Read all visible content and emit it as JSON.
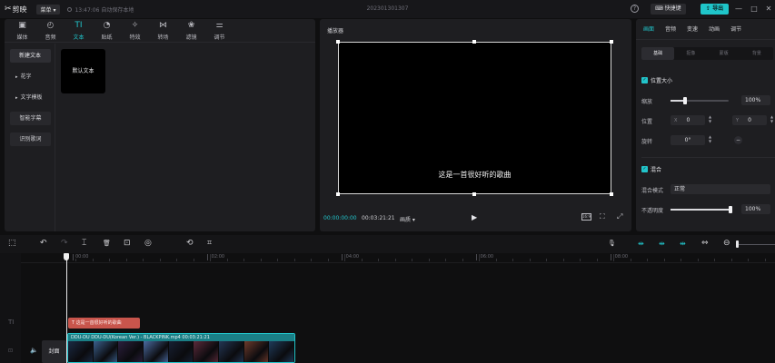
{
  "app": {
    "name": "剪映",
    "menu_label": "菜单",
    "save_status": "13:47:06 自动保存本地",
    "project_name": "202301301307",
    "help": "?",
    "shortcut_label": "快捷键",
    "export_label": "导出",
    "window_controls": {
      "minimize": "—",
      "maximize": "□",
      "close": "✕"
    }
  },
  "media": {
    "tabs": [
      {
        "label": "媒体",
        "icon": "media-icon",
        "glyph": "▣",
        "active": false
      },
      {
        "label": "音频",
        "icon": "audio-icon",
        "glyph": "◴",
        "active": false
      },
      {
        "label": "文本",
        "icon": "text-icon",
        "glyph": "TI",
        "active": true
      },
      {
        "label": "贴纸",
        "icon": "sticker-icon",
        "glyph": "◔",
        "active": false
      },
      {
        "label": "特效",
        "icon": "effects-icon",
        "glyph": "✧",
        "active": false
      },
      {
        "label": "转场",
        "icon": "transition-icon",
        "glyph": "⋈",
        "active": false
      },
      {
        "label": "滤镜",
        "icon": "filter-icon",
        "glyph": "❀",
        "active": false
      },
      {
        "label": "调节",
        "icon": "adjust-icon",
        "glyph": "⚌",
        "active": false
      }
    ],
    "sidebar": [
      {
        "label": "新建文本",
        "style": "active"
      },
      {
        "label": "花字",
        "style": "caret"
      },
      {
        "label": "文字模板",
        "style": "caret"
      },
      {
        "label": "智能字幕",
        "style": "plain"
      },
      {
        "label": "识别歌词",
        "style": "plain"
      }
    ],
    "caret_glyph": "▸",
    "preset_card": "默认文本"
  },
  "player": {
    "title": "播放器",
    "subtitle": "这是一首很好听的歌曲",
    "current_time": "00:00:00:00",
    "total_time": "00:03:21:21",
    "quality": "画质 ▾",
    "play_glyph": "▶",
    "ratio_glyph": "16:9",
    "expand_glyph": "⛶",
    "fullscreen_glyph": "⤢"
  },
  "properties": {
    "tabs": [
      {
        "label": "画面",
        "active": true
      },
      {
        "label": "音频",
        "active": false
      },
      {
        "label": "变速",
        "active": false
      },
      {
        "label": "动画",
        "active": false
      },
      {
        "label": "调节",
        "active": false
      }
    ],
    "subtabs": [
      {
        "label": "基础",
        "active": true
      },
      {
        "label": "抠像",
        "active": false
      },
      {
        "label": "蒙版",
        "active": false
      },
      {
        "label": "背景",
        "active": false
      }
    ],
    "check_glyph": "✓",
    "position_size": {
      "title": "位置大小",
      "scale_label": "缩放",
      "scale_value": "100%",
      "scale_fraction": 0.25,
      "position_label": "位置",
      "x_axis": "X",
      "x_value": "0",
      "y_axis": "Y",
      "y_value": "0",
      "rotate_label": "旋转",
      "rotate_value": "0°",
      "reset_glyph": "−"
    },
    "blend": {
      "title": "混合",
      "mode_label": "混合模式",
      "mode_value": "正常",
      "opacity_label": "不透明度",
      "opacity_value": "100%",
      "opacity_fraction": 1.0
    },
    "step_up": "▲",
    "step_down": "▼"
  },
  "timeline": {
    "tools": {
      "select": "⬚",
      "undo": "↶",
      "redo": "↷",
      "split": "⌶",
      "delete": "🗑",
      "freeze": "⊡",
      "reverse": "◎",
      "mirror": "⟲",
      "crop": "⌗",
      "mic": "🎙",
      "link_a": "⇹",
      "link_b": "⇹",
      "link_c": "⇹",
      "align": "⇔",
      "zoom_out": "⊖"
    },
    "ruler_ticks": [
      "00:00",
      "|02:00",
      "|04:00",
      "|06:00",
      "|08:00"
    ],
    "text_track_label": "TI",
    "text_clip_label": "这是一首很好听的歌曲",
    "video_track_icon": "⊡",
    "audio_icon": "🔈",
    "cover_label": "封面",
    "video_clip_name": "DDU-DU DDU-DU(Korean Ver.) - BLACKPINK.mp4  00:03:21:21",
    "frame_colors": [
      "#1a2a44",
      "#3a5f8c",
      "#2b1f3d",
      "#4a6aa0",
      "#172033",
      "#5b2a3a",
      "#233654",
      "#6d3a2c",
      "#1f3b5a"
    ]
  }
}
